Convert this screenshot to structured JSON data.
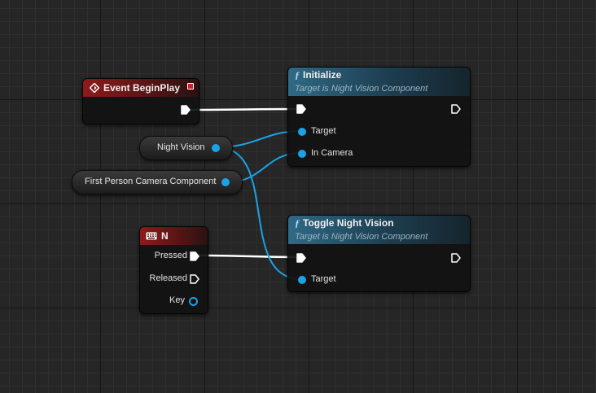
{
  "colors": {
    "exec_wire": "#ffffff",
    "object_wire": "#1ba2e6",
    "event_header": "#8e1a1a",
    "function_header": "#2f6a86"
  },
  "nodes": {
    "event_begin_play": {
      "title": "Event BeginPlay",
      "icon": "event-diamond-icon"
    },
    "initialize": {
      "title": "Initialize",
      "subtitle": "Target is Night Vision Component",
      "pins": {
        "target": "Target",
        "in_camera": "In Camera"
      },
      "icon": "function-icon"
    },
    "night_vision_var": {
      "label": "Night Vision"
    },
    "camera_var": {
      "label": "First Person Camera Component"
    },
    "key_n": {
      "title": "N",
      "icon": "keyboard-icon",
      "pins": {
        "pressed": "Pressed",
        "released": "Released",
        "key": "Key"
      }
    },
    "toggle_night_vision": {
      "title": "Toggle Night Vision",
      "subtitle": "Target is Night Vision Component",
      "pins": {
        "target": "Target"
      },
      "icon": "function-icon"
    }
  }
}
